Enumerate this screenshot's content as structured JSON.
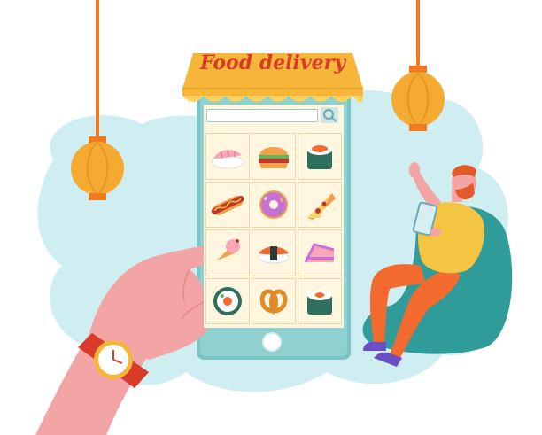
{
  "awning": {
    "title": "Food delivery"
  },
  "search": {
    "placeholder": ""
  },
  "menu_items": [
    {
      "name": "shrimp-sushi-icon"
    },
    {
      "name": "burger-icon"
    },
    {
      "name": "sushi-roll-icon"
    },
    {
      "name": "hotdog-icon"
    },
    {
      "name": "donut-icon"
    },
    {
      "name": "pizza-slice-icon"
    },
    {
      "name": "ice-cream-cone-icon"
    },
    {
      "name": "salmon-nigiri-icon"
    },
    {
      "name": "cake-slice-icon"
    },
    {
      "name": "maki-roll-icon"
    },
    {
      "name": "pretzel-icon"
    },
    {
      "name": "salmon-roll-icon"
    }
  ],
  "colors": {
    "blob": "#cfeef2",
    "phone_body": "#7cc4c4",
    "awning_yellow": "#f6b63a",
    "awning_title": "#d93a2a",
    "lantern": "#f5ab32",
    "cord": "#f07a22",
    "hand": "#f3a5a5",
    "pants": "#f26a2e",
    "shirt": "#f4c542",
    "beanbag": "#2f9c9a"
  }
}
